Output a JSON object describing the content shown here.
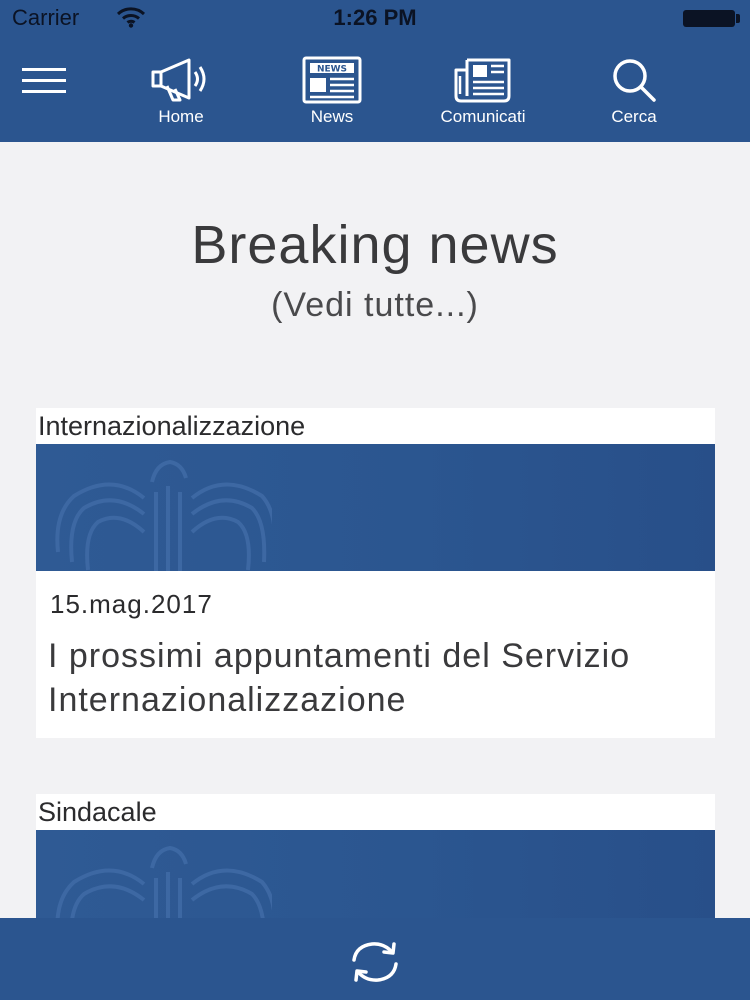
{
  "status_bar": {
    "carrier": "Carrier",
    "time": "1:26 PM",
    "wifi_icon": "wifi-icon",
    "battery_icon": "battery-icon"
  },
  "nav": {
    "menu_icon": "hamburger-menu-icon",
    "items": [
      {
        "label": "Home",
        "icon": "megaphone-icon"
      },
      {
        "label": "News",
        "icon": "newspaper-news-icon"
      },
      {
        "label": "Comunicati",
        "icon": "press-releases-icon"
      },
      {
        "label": "Cerca",
        "icon": "search-icon"
      }
    ]
  },
  "main": {
    "title": "Breaking news",
    "see_all": "(Vedi tutte...)",
    "cards": [
      {
        "category": "Internazionalizzazione",
        "date": "15.mag.2017",
        "title": "I prossimi appuntamenti del Servizio Internazionalizzazione",
        "banner_icon": "eagle-logo-icon"
      },
      {
        "category": "Sindacale",
        "banner_icon": "eagle-logo-icon"
      }
    ]
  },
  "footer": {
    "refresh_icon": "refresh-icon"
  },
  "colors": {
    "header_blue": "#2b558f",
    "banner_blue": "#2b5690",
    "background": "#f2f2f4",
    "text_dark": "#3a3a3c"
  }
}
